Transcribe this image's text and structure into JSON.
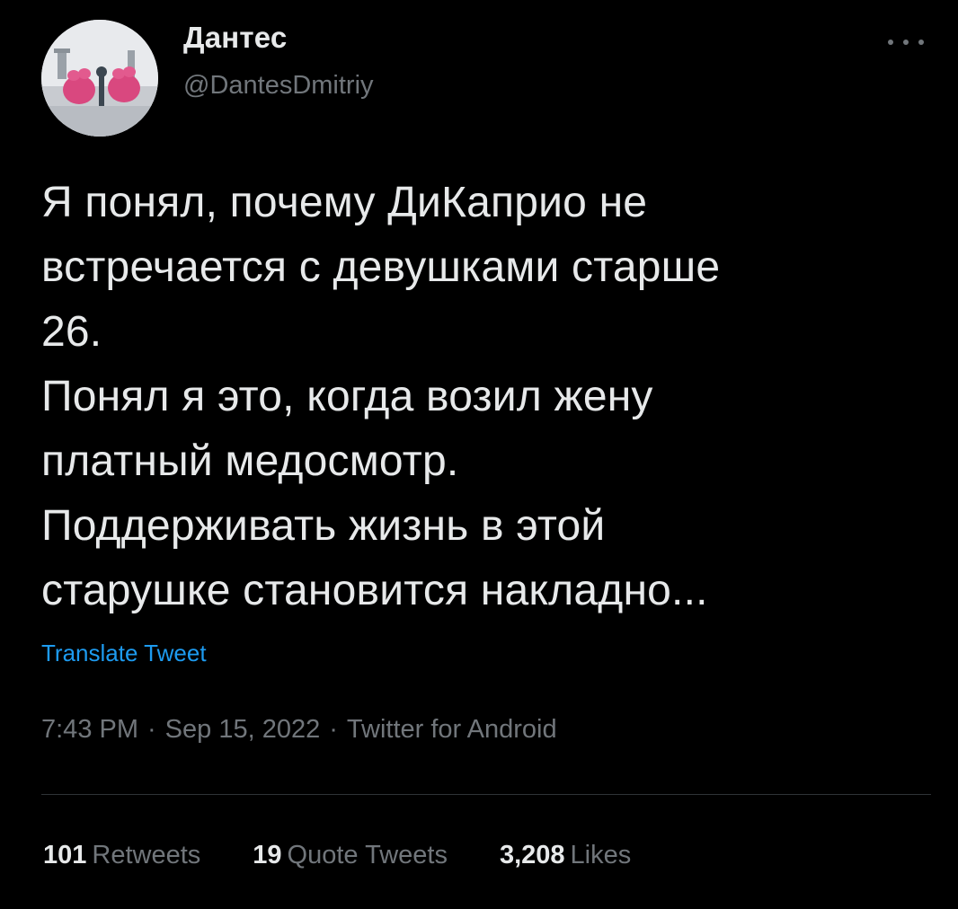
{
  "author": {
    "display_name": "Дантес",
    "handle": "@DantesDmitriy"
  },
  "tweet": {
    "text": "Я понял, почему ДиКаприо не\nвстречается с девушками старше\n26.\nПонял я это, когда возил жену\nплатный медосмотр.\nПоддерживать жизнь в этой\nстарушке становится накладно...",
    "translate_label": "Translate Tweet",
    "time": "7:43 PM",
    "date": "Sep 15, 2022",
    "source": "Twitter for Android",
    "separator": "·"
  },
  "stats": {
    "retweets": {
      "count": "101",
      "label": "Retweets"
    },
    "quotes": {
      "count": "19",
      "label": "Quote Tweets"
    },
    "likes": {
      "count": "3,208",
      "label": "Likes"
    }
  },
  "icons": {
    "more": "more-horizontal-icon",
    "avatar": "avatar-photo"
  },
  "colors": {
    "background": "#000000",
    "text": "#e7e9ea",
    "muted": "#71767b",
    "accent": "#1d9bf0",
    "divider": "#2f3336"
  }
}
